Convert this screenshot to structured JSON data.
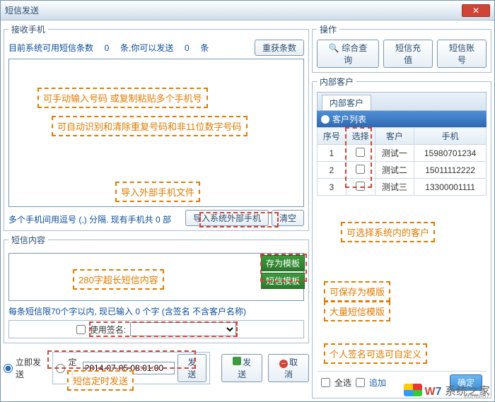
{
  "window": {
    "title": "短信发送"
  },
  "recv": {
    "legend": "接收手机",
    "quota_pre": "目前系统可用短信条数",
    "quota_count": "0",
    "quota_unit": "条,你可以发送",
    "send_count": "0",
    "send_unit": "条",
    "refresh_btn": "重获条数",
    "phone_hint": "多个手机间用逗号 (,) 分隔. 现有手机共 0 部",
    "import_btn": "导入系统外部手机",
    "clear_btn": "清空"
  },
  "msg": {
    "legend": "短信内容",
    "save_tpl": "存为模板",
    "sms_tpl": "短信模板",
    "limit_hint": "每条短信限70个字以内, 现已输入 0 个字 (含签名 不含客户名称)",
    "sig_label": "使用签名:",
    "now_radio": "立即发送",
    "sched_radio": "定于",
    "sched_time": "2014-07-05 08:01:00",
    "sched_send": "发送",
    "send_btn": "发送",
    "cancel_btn": "取消"
  },
  "ops": {
    "legend": "操作",
    "query": "综合查询",
    "recharge": "短信充值",
    "account": "短信账号"
  },
  "cust": {
    "legend": "内部客户",
    "list_title": "客户列表",
    "cols": {
      "seq": "序号",
      "sel": "选择",
      "name": "客户",
      "phone": "手机"
    },
    "rows": [
      {
        "seq": "1",
        "name": "测试一",
        "phone": "15980701234"
      },
      {
        "seq": "2",
        "name": "测试二",
        "phone": "15011112222"
      },
      {
        "seq": "3",
        "name": "测试三",
        "phone": "13300001111"
      }
    ],
    "all": "全选",
    "add": "追加",
    "ok": "确定"
  },
  "ann": {
    "a1": "可手动输入号码 或复制粘贴多个手机号",
    "a2": "可自动识别和清除重复号码和非11位数字号码",
    "a3": "导入外部手机文件",
    "a4": "280字超长短信内容",
    "a5": "短信定时发送",
    "a6": "可选择系统内的客户",
    "a7": "可保存为模版",
    "a8": "大量短信模版",
    "a9": "个人签名可选可自定义"
  },
  "wm": {
    "site": "系统之家",
    "url": "Winwin7"
  }
}
